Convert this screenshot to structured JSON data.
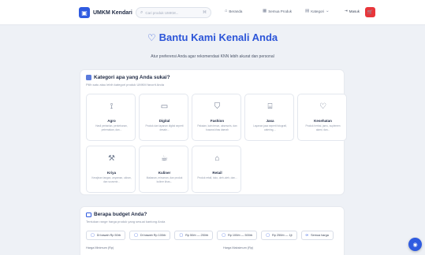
{
  "header": {
    "brand": "UMKM Kendari",
    "search_placeholder": "Cari produk UMKM...",
    "search_shortcut": "⌘",
    "nav": [
      {
        "label": "Beranda",
        "icon": "home-icon"
      },
      {
        "label": "Semua Produk",
        "icon": "grid-icon"
      },
      {
        "label": "Kategori",
        "icon": "category-icon"
      }
    ],
    "login_label": "Masuk"
  },
  "hero": {
    "title": "Bantu Kami Kenali Anda",
    "subtitle": "Atur preferensi Anda agar rekomendasi KNN lebih akurat dan personal"
  },
  "category_section": {
    "title": "Kategori apa yang Anda sukai?",
    "subtitle": "Pilih satu atau lebih kategori produk UMKM favorit Anda",
    "items": [
      {
        "name": "Agro",
        "desc": "Hasil pertanian, perkebunan, peternakan, dan...",
        "icon": "sprout-icon"
      },
      {
        "name": "Digital",
        "desc": "Produk dan layanan digital seperti desain...",
        "icon": "laptop-icon"
      },
      {
        "name": "Fashion",
        "desc": "Pakaian, kain tenun, aksesoris, dan busana khas daerah",
        "icon": "shirt-icon"
      },
      {
        "name": "Jasa",
        "desc": "Layanan jasa seperti fotografi, catering,...",
        "icon": "briefcase-icon"
      },
      {
        "name": "Kesehatan",
        "desc": "Produk herbal, jamu, suplemen alami, dan...",
        "icon": "heart-pulse-icon"
      },
      {
        "name": "Kriya",
        "desc": "Kerajinan tangan, anyaman, ukiran, dan souvenir...",
        "icon": "hammer-icon"
      },
      {
        "name": "Kuliner",
        "desc": "Makanan, minuman, dan produk kuliner khas...",
        "icon": "cup-icon"
      },
      {
        "name": "Retail",
        "desc": "Produk retail, toko, oleh-oleh, dan...",
        "icon": "store-icon"
      }
    ]
  },
  "budget_section": {
    "title": "Berapa budget Anda?",
    "subtitle": "Tentukan range harga produk yang sesuai kantong Anda",
    "options": [
      "Di bawah Rp 50rb",
      "Di bawah Rp 100rb",
      "Rp 50rb — 250rb",
      "Rp 100rb — 500rb",
      "Rp 250rb — 1jt",
      "Semua harga"
    ],
    "min_label": "Harga Minimum (Rp)",
    "max_label": "Harga Maksimum (Rp)"
  },
  "colors": {
    "primary": "#2f5be0",
    "cart": "#e8363b"
  }
}
